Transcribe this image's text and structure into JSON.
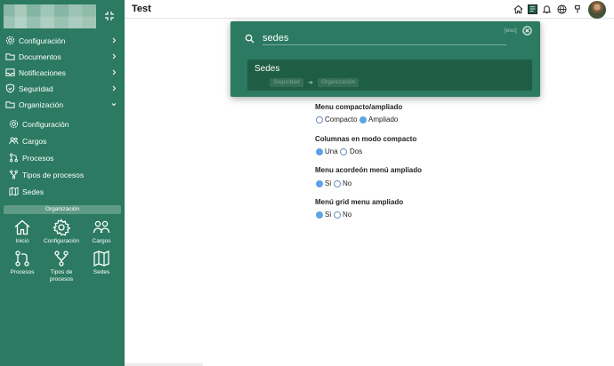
{
  "sidebar": {
    "menu": [
      {
        "label": "Configuración",
        "icon": "gear-icon"
      },
      {
        "label": "Documentos",
        "icon": "folder-icon"
      },
      {
        "label": "Notificaciones",
        "icon": "inbox-icon"
      },
      {
        "label": "Seguridad",
        "icon": "shield-icon"
      },
      {
        "label": "Organización",
        "icon": "folder-icon"
      }
    ],
    "sub_items": [
      {
        "label": "Configuración",
        "icon": "gear-icon"
      },
      {
        "label": "Cargos",
        "icon": "people-icon"
      },
      {
        "label": "Procesos",
        "icon": "git-pull-icon"
      },
      {
        "label": "Tipos de procesos",
        "icon": "git-fork-icon"
      },
      {
        "label": "Sedes",
        "icon": "map-icon"
      }
    ],
    "section_title": "Organización",
    "grid": [
      {
        "label": "Inicio",
        "icon": "home-icon"
      },
      {
        "label": "Configuración",
        "icon": "gear-icon"
      },
      {
        "label": "Cargos",
        "icon": "people-icon"
      },
      {
        "label": "Procesos",
        "icon": "git-pull-icon"
      },
      {
        "label": "Tipos de procesos",
        "icon": "git-fork-icon"
      },
      {
        "label": "Sedes",
        "icon": "map-icon"
      }
    ]
  },
  "header": {
    "title": "Test",
    "icons": [
      "home-icon",
      "notebook-icon",
      "bell-icon",
      "globe-icon",
      "pin-icon"
    ]
  },
  "search": {
    "query": "sedes",
    "esc_hint": "[esc]",
    "result": {
      "title": "Sedes",
      "path": [
        "Seguridad",
        "Organización"
      ]
    }
  },
  "settings": [
    {
      "label": "Menu compacto/ampliado",
      "options": [
        "Compacto",
        "Ampliado"
      ],
      "selected": 1
    },
    {
      "label": "Columnas en modo compacto",
      "options": [
        "Una",
        "Dos"
      ],
      "selected": 0
    },
    {
      "label": "Menu acordeón menú ampliado",
      "options": [
        "Si",
        "No"
      ],
      "selected": 0
    },
    {
      "label": "Menú grid menu ampliado",
      "options": [
        "Si",
        "No"
      ],
      "selected": 0
    }
  ],
  "colors": {
    "sidebar": "#2b7a61",
    "result_bg": "#1f5e46",
    "radio_on": "#5ea3e6"
  }
}
